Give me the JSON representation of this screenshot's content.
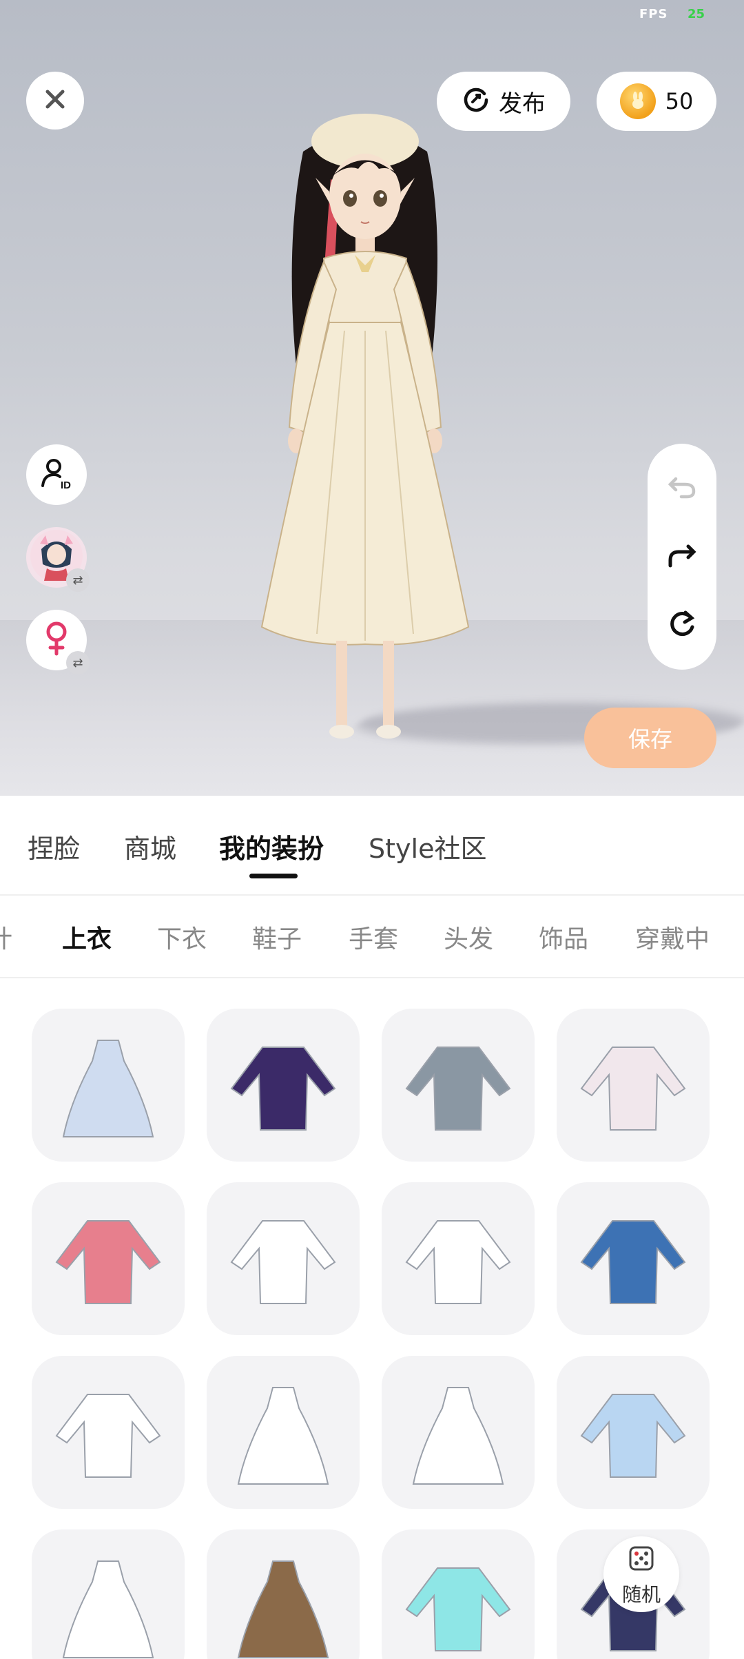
{
  "fps": {
    "label": "FPS",
    "value": "25"
  },
  "top_bar": {
    "publish_label": "发布",
    "coin_count": "50"
  },
  "side_buttons": {
    "id_badge": "ID"
  },
  "save_label": "保存",
  "main_tabs": [
    "捏脸",
    "商城",
    "我的装扮",
    "Style社区"
  ],
  "active_main_tab": "我的装扮",
  "sub_tabs": [
    "计",
    "上衣",
    "下衣",
    "鞋子",
    "手套",
    "头发",
    "饰品",
    "穿戴中"
  ],
  "active_sub_tab": "上衣",
  "items": [
    {
      "name": "white-ruffle-gown",
      "color": "#cfdcf0"
    },
    {
      "name": "purple-plaid-outfit",
      "color": "#3b2a68"
    },
    {
      "name": "grey-school-uniform",
      "color": "#8a97a3"
    },
    {
      "name": "white-cardigan-sailor",
      "color": "#f1e7ec"
    },
    {
      "name": "pink-outline-shirt",
      "color": "#e77f8d"
    },
    {
      "name": "white-shirt-bow",
      "color": "#ffffff"
    },
    {
      "name": "sailor-top-pink-bow",
      "color": "#ffffff"
    },
    {
      "name": "blue-blazer",
      "color": "#3d72b4"
    },
    {
      "name": "white-blouse",
      "color": "#ffffff"
    },
    {
      "name": "white-apron-dress",
      "color": "#ffffff"
    },
    {
      "name": "white-long-dress",
      "color": "#ffffff"
    },
    {
      "name": "light-blue-shirt-tie",
      "color": "#b9d6f2"
    },
    {
      "name": "white-coat-dress",
      "color": "#ffffff"
    },
    {
      "name": "brown-apron-dress",
      "color": "#8b6a49"
    },
    {
      "name": "aqua-swimsuit",
      "color": "#8ee6e6"
    },
    {
      "name": "navy-crop-top",
      "color": "#353866"
    }
  ],
  "random_label": "随机",
  "colors": {
    "save_button": "#f9c19a",
    "fps_value": "#38d14a",
    "cell_bg": "#f3f3f5"
  }
}
